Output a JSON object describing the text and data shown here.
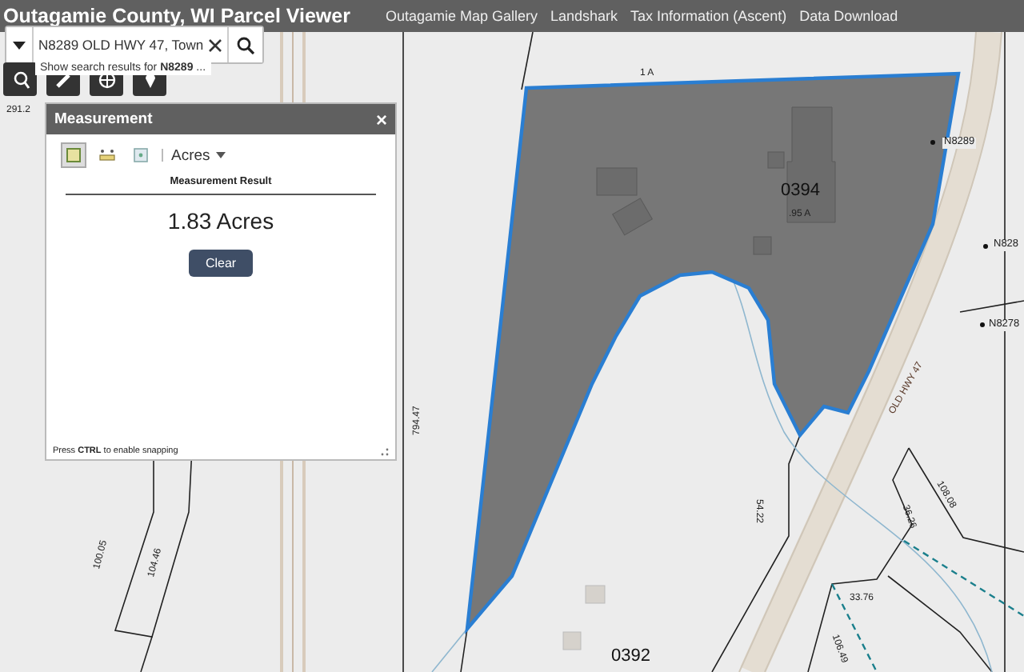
{
  "header": {
    "title": "Outagamie County, WI Parcel Viewer",
    "links": [
      "Outagamie Map Gallery",
      "Landshark",
      "Tax Information (Ascent)",
      "Data Download"
    ]
  },
  "search": {
    "value": "N8289 OLD HWY 47, Town",
    "suggestion": "Show search results for **N8289** ..."
  },
  "measurement": {
    "title": "Measurement",
    "close": "×",
    "tools": [
      {
        "kind": "area",
        "selected": true
      },
      {
        "kind": "distance",
        "selected": false
      },
      {
        "kind": "location",
        "selected": false
      }
    ],
    "unit": "Acres",
    "result_heading": "Measurement Result",
    "result": "1.83 Acres",
    "clear_button": "Clear",
    "hint": "Press **CTRL** to enable snapping"
  },
  "map": {
    "labels": [
      {
        "kind": "dim",
        "text": "1 A"
      },
      {
        "kind": "dim",
        "text": "291.2"
      },
      {
        "kind": "parcel",
        "text": "0394"
      },
      {
        "kind": "dim",
        "text": ".95 A"
      },
      {
        "kind": "address",
        "text": "N8289"
      },
      {
        "kind": "address",
        "text": "N828"
      },
      {
        "kind": "address",
        "text": "N8278"
      },
      {
        "kind": "dim",
        "text": "794.47"
      },
      {
        "kind": "road",
        "text": "OLD HWY 47"
      },
      {
        "kind": "dim",
        "text": "54.22"
      },
      {
        "kind": "dim",
        "text": "36.26"
      },
      {
        "kind": "dim",
        "text": "108.08"
      },
      {
        "kind": "dim",
        "text": "33.76"
      },
      {
        "kind": "dim",
        "text": "106.49"
      },
      {
        "kind": "dim",
        "text": "100.05"
      },
      {
        "kind": "dim",
        "text": "104.46"
      },
      {
        "kind": "parcel",
        "text": "0392"
      }
    ]
  }
}
